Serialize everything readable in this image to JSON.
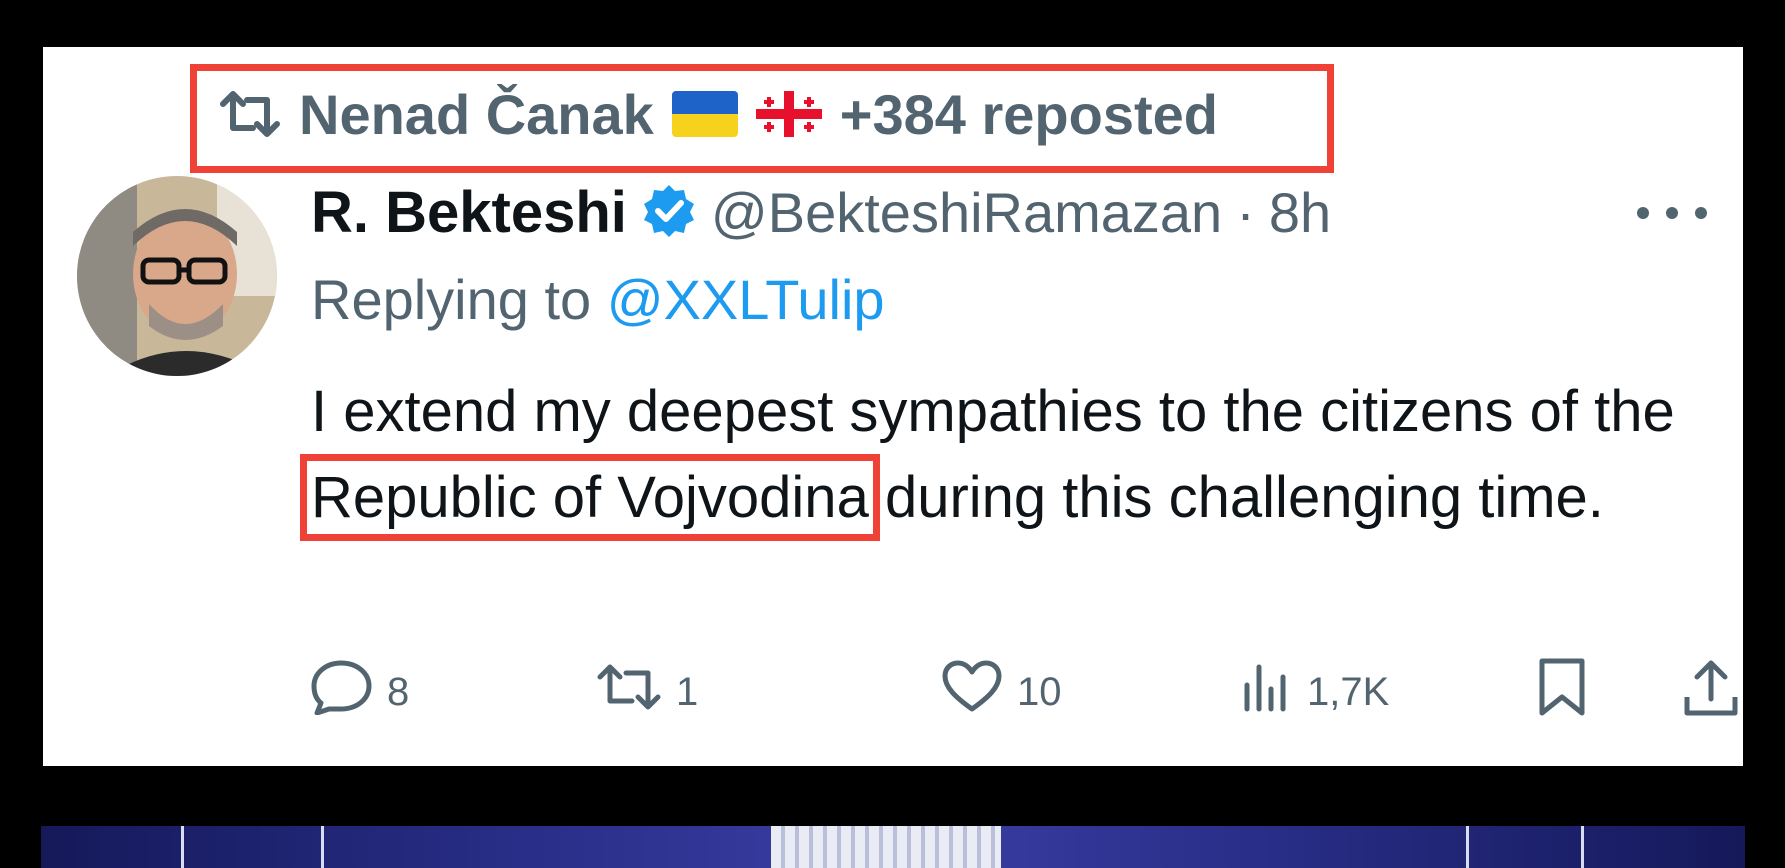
{
  "repost": {
    "label": "Nenad Čanak",
    "extra": "+384 reposted",
    "flags": [
      "ukraine-flag",
      "georgia-flag"
    ]
  },
  "tweet": {
    "display_name": "R. Bekteshi",
    "handle": "@BekteshiRamazan",
    "separator": "·",
    "time": "8h",
    "replying_prefix": "Replying to",
    "replying_to": "@XXLTulip",
    "text_before": "I extend my deepest sympathies to the citizens of the ",
    "text_highlight": "Republic of Vojvodina",
    "text_after": " during this challenging time."
  },
  "actions": {
    "replies": "8",
    "reposts": "1",
    "likes": "10",
    "views": "1,7K"
  },
  "colors": {
    "highlight": "#ef4135",
    "secondary_text": "#536471",
    "link": "#1d9bf0",
    "verified": "#1d9bf0"
  }
}
